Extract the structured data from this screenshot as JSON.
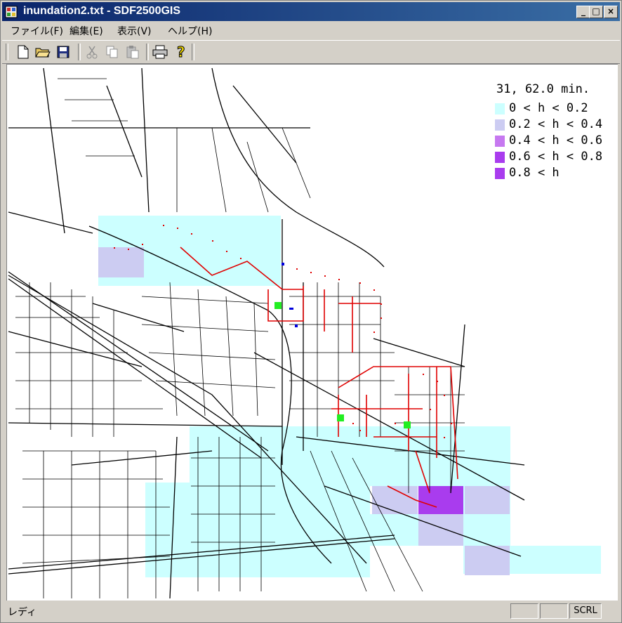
{
  "window": {
    "title": "inundation2.txt - SDF2500GIS"
  },
  "menu": [
    "ファイル(F)",
    "編集(E)",
    "表示(V)",
    "ヘルプ(H)"
  ],
  "toolbar": {
    "buttons": [
      "new-file-icon",
      "open-folder-icon",
      "save-icon",
      "cut-icon",
      "copy-icon",
      "paste-icon",
      "print-icon",
      "help-icon"
    ]
  },
  "legend": {
    "title": "31, 62.0 min.",
    "items": [
      {
        "label": "0 < h < 0.2",
        "color": "#ccffff"
      },
      {
        "label": "0.2 < h < 0.4",
        "color": "#ccccf2"
      },
      {
        "label": "0.4 < h < 0.6",
        "color": "#c678f0"
      },
      {
        "label": "0.6 < h < 0.8",
        "color": "#a93cee"
      },
      {
        "label": "0.8 < h",
        "color": "#a93cee"
      }
    ]
  },
  "status": {
    "text": "レディ",
    "indicators": [
      "",
      "",
      "SCRL"
    ]
  }
}
